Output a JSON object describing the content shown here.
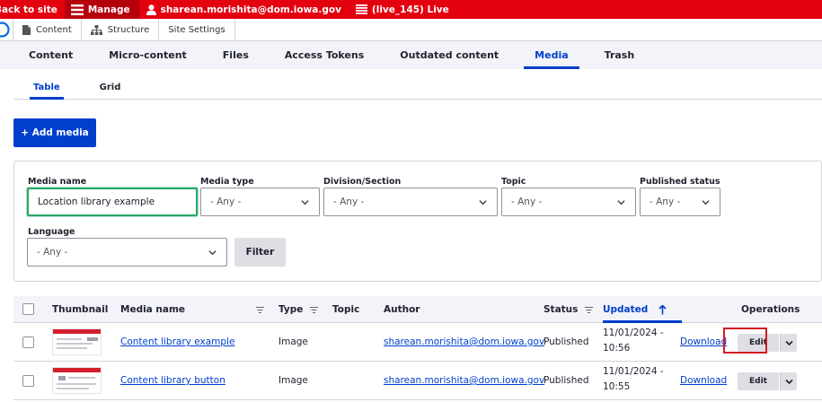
{
  "toolbar": {
    "back_label": "Back to site",
    "manage_label": "Manage",
    "user_label": "sharean.morishita@dom.iowa.gov",
    "env_label": "(live_145) Live"
  },
  "tray": {
    "items": [
      {
        "label": "Content",
        "icon": "file-icon"
      },
      {
        "label": "Structure",
        "icon": "structure-icon"
      },
      {
        "label": "Site Settings"
      }
    ]
  },
  "primary_tabs": [
    {
      "label": "Content"
    },
    {
      "label": "Micro-content"
    },
    {
      "label": "Files"
    },
    {
      "label": "Access Tokens"
    },
    {
      "label": "Outdated content"
    },
    {
      "label": "Media",
      "active": true
    },
    {
      "label": "Trash"
    }
  ],
  "secondary_tabs": [
    {
      "label": "Table",
      "active": true
    },
    {
      "label": "Grid"
    }
  ],
  "add_media_label": "+ Add media",
  "filters": {
    "media_name": {
      "label": "Media name",
      "value": "Location library example"
    },
    "media_type": {
      "label": "Media type",
      "value": "- Any -"
    },
    "division": {
      "label": "Division/Section",
      "value": "- Any -"
    },
    "topic": {
      "label": "Topic",
      "value": "- Any -"
    },
    "published": {
      "label": "Published status",
      "value": "- Any -"
    },
    "language": {
      "label": "Language",
      "value": "- Any -"
    },
    "filter_button": "Filter"
  },
  "table": {
    "columns": {
      "thumbnail": "Thumbnail",
      "media_name": "Media name",
      "type": "Type",
      "topic": "Topic",
      "author": "Author",
      "status": "Status",
      "updated": "Updated",
      "operations": "Operations"
    },
    "rows": [
      {
        "name": "Content library example",
        "type": "Image",
        "topic": "",
        "author": "sharean.morishita@dom.iowa.gov",
        "status": "Published",
        "updated_date": "11/01/2024 -",
        "updated_time": "10:56",
        "download": "Download",
        "edit": "Edit"
      },
      {
        "name": "Content library button",
        "type": "Image",
        "topic": "",
        "author": "sharean.morishita@dom.iowa.gov",
        "status": "Published",
        "updated_date": "11/01/2024 -",
        "updated_time": "10:55",
        "download": "Download",
        "edit": "Edit"
      }
    ]
  },
  "colors": {
    "toolbar_red": "#e3000f",
    "accent_blue": "#003ecc",
    "focus_green": "#26a769",
    "highlight_red": "#d21b20"
  }
}
